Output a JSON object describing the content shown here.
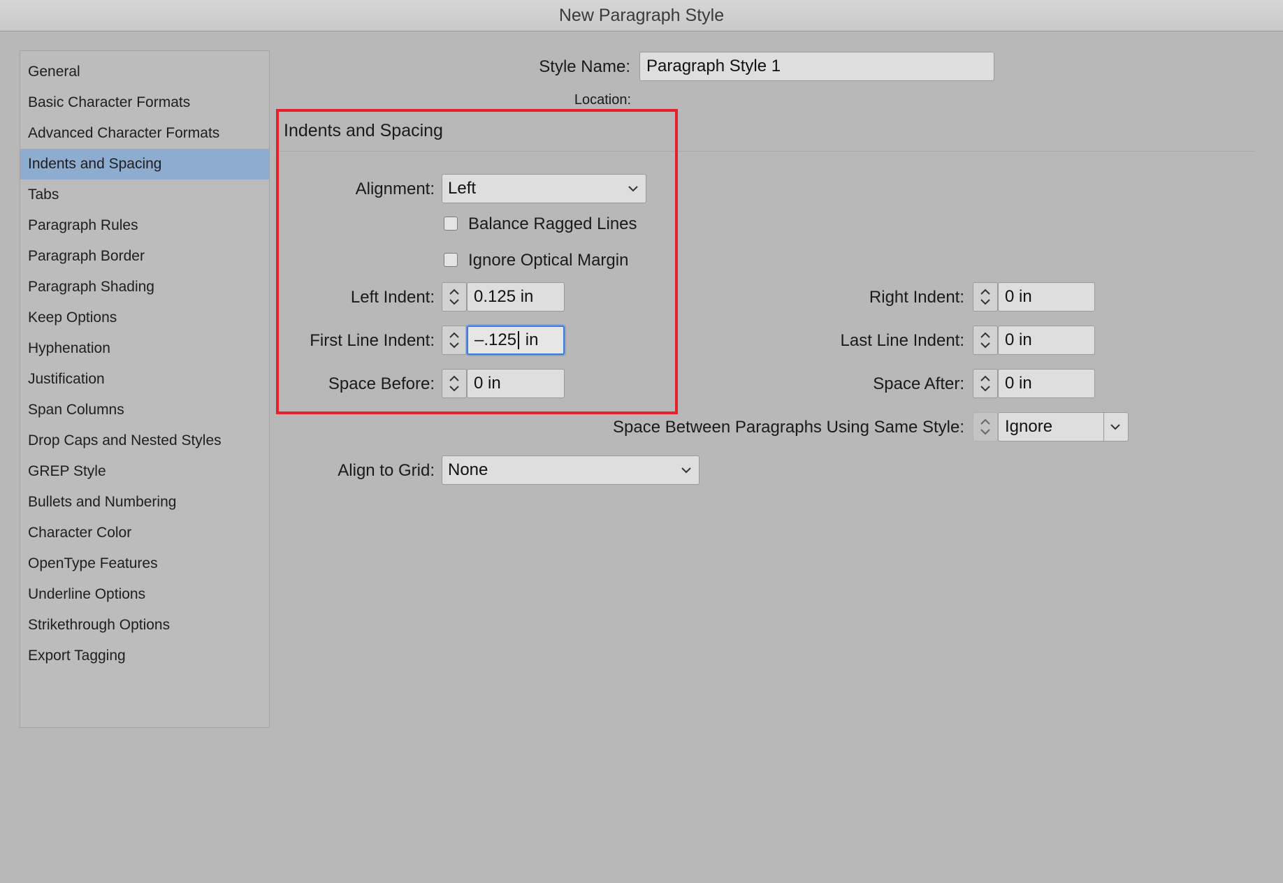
{
  "window": {
    "title": "New Paragraph Style"
  },
  "sidebar": {
    "items": [
      {
        "label": "General"
      },
      {
        "label": "Basic Character Formats"
      },
      {
        "label": "Advanced Character Formats"
      },
      {
        "label": "Indents and Spacing",
        "selected": true
      },
      {
        "label": "Tabs"
      },
      {
        "label": "Paragraph Rules"
      },
      {
        "label": "Paragraph Border"
      },
      {
        "label": "Paragraph Shading"
      },
      {
        "label": "Keep Options"
      },
      {
        "label": "Hyphenation"
      },
      {
        "label": "Justification"
      },
      {
        "label": "Span Columns"
      },
      {
        "label": "Drop Caps and Nested Styles"
      },
      {
        "label": "GREP Style"
      },
      {
        "label": "Bullets and Numbering"
      },
      {
        "label": "Character Color"
      },
      {
        "label": "OpenType Features"
      },
      {
        "label": "Underline Options"
      },
      {
        "label": "Strikethrough Options"
      },
      {
        "label": "Export Tagging"
      }
    ]
  },
  "header": {
    "style_name_label": "Style Name:",
    "style_name_value": "Paragraph Style 1",
    "location_label": "Location:"
  },
  "section": {
    "title": "Indents and Spacing"
  },
  "form": {
    "alignment": {
      "label": "Alignment:",
      "value": "Left"
    },
    "balance_ragged_lines": {
      "label": "Balance Ragged Lines",
      "checked": false
    },
    "ignore_optical_margin": {
      "label": "Ignore Optical Margin",
      "checked": false
    },
    "left_indent": {
      "label": "Left Indent:",
      "value": "0.125 in"
    },
    "first_line_indent": {
      "label": "First Line Indent:",
      "value_before_caret": "–.125",
      "value_after_caret": " in"
    },
    "space_before": {
      "label": "Space Before:",
      "value": "0 in"
    },
    "right_indent": {
      "label": "Right Indent:",
      "value": "0 in"
    },
    "last_line_indent": {
      "label": "Last Line Indent:",
      "value": "0 in"
    },
    "space_after": {
      "label": "Space After:",
      "value": "0 in"
    },
    "space_between": {
      "label": "Space Between Paragraphs Using Same Style:",
      "value": "Ignore"
    },
    "align_to_grid": {
      "label": "Align to Grid:",
      "value": "None"
    }
  },
  "colors": {
    "background": "#b8b8b8",
    "selection": "#8eaccf",
    "highlight_box": "#e8202b",
    "focus_ring": "#3d7be0"
  }
}
